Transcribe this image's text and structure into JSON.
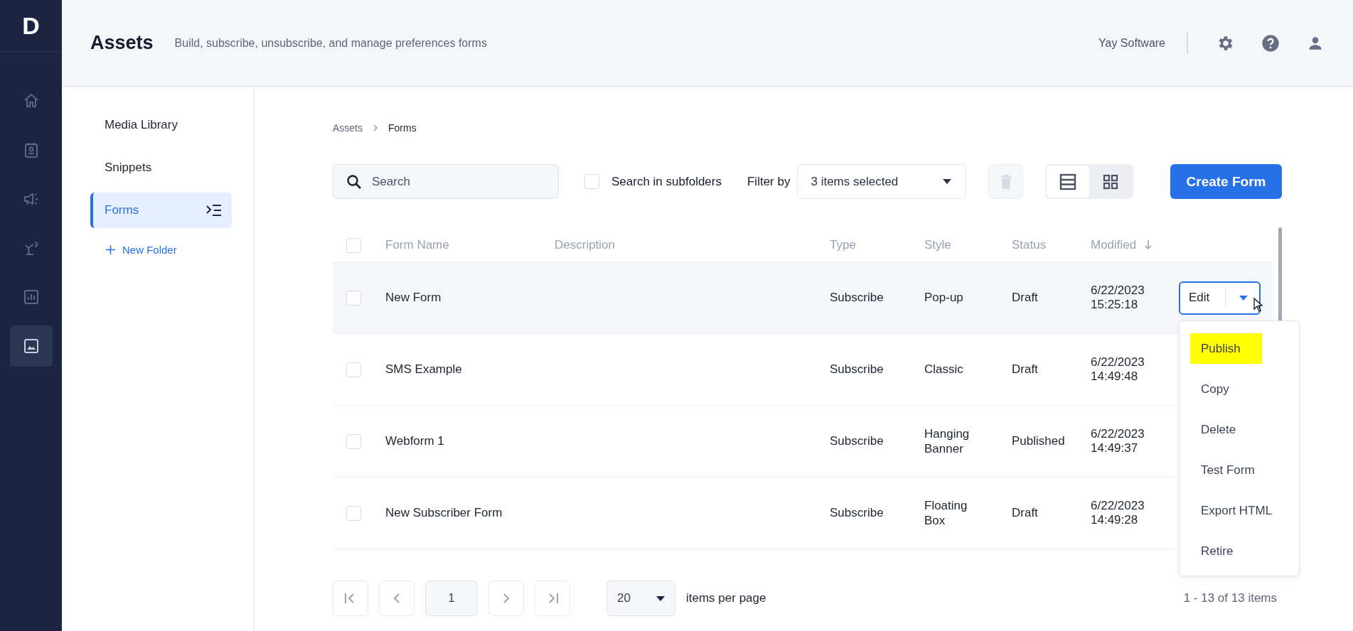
{
  "rail": {
    "logo": "D",
    "items": [
      {
        "kind": "home",
        "selected": false
      },
      {
        "kind": "contacts",
        "selected": false
      },
      {
        "kind": "campaigns",
        "selected": false
      },
      {
        "kind": "automation",
        "selected": false
      },
      {
        "kind": "reports",
        "selected": false
      },
      {
        "kind": "assets",
        "selected": true
      }
    ]
  },
  "header": {
    "title": "Assets",
    "subtitle": "Build, subscribe, unsubscribe, and manage preferences forms",
    "account": "Yay Software"
  },
  "side_panel": {
    "items": [
      {
        "label": "Media Library",
        "selected": false
      },
      {
        "label": "Snippets",
        "selected": false
      },
      {
        "label": "Forms",
        "selected": true
      }
    ],
    "new_folder": "New Folder"
  },
  "breadcrumb": [
    "Assets",
    "Forms"
  ],
  "toolbar": {
    "search": {
      "placeholder": "Search"
    },
    "subfolders": {
      "label": "Search in subfolders",
      "checked": false
    },
    "filter_label": "Filter by",
    "filter_value": "3 items selected",
    "views": [
      {
        "kind": "list",
        "selected": true
      },
      {
        "kind": "grid",
        "selected": false
      }
    ],
    "create_button": "Create Form"
  },
  "table": {
    "all_checked": false,
    "columns": [
      {
        "label": "Form Name",
        "sorted": false
      },
      {
        "label": "Description",
        "sorted": false
      },
      {
        "label": "Type",
        "sorted": false
      },
      {
        "label": "Style",
        "sorted": false
      },
      {
        "label": "Status",
        "sorted": false
      },
      {
        "label": "Modified",
        "sorted": true
      }
    ],
    "rows": [
      {
        "checked": false,
        "hovered": true,
        "name": "New Form",
        "type": "Subscribe",
        "style": "Pop-up",
        "status": "Draft",
        "date": "6/22/2023",
        "time": "15:25:18"
      },
      {
        "checked": false,
        "hovered": false,
        "name": "SMS Example",
        "type": "Subscribe",
        "style": "Classic",
        "status": "Draft",
        "date": "6/22/2023",
        "time": "14:49:48"
      },
      {
        "checked": false,
        "hovered": false,
        "name": "Webform 1",
        "type": "Subscribe",
        "style": "Hanging Banner",
        "status": "Published",
        "date": "6/22/2023",
        "time": "14:49:37"
      },
      {
        "checked": false,
        "hovered": false,
        "name": "New Subscriber Form",
        "type": "Subscribe",
        "style": "Floating Box",
        "status": "Draft",
        "date": "6/22/2023",
        "time": "14:49:28"
      }
    ],
    "row_action": "Edit"
  },
  "action_menu": {
    "items": [
      {
        "label": "Publish",
        "highlighted": true
      },
      {
        "label": "Copy",
        "highlighted": false
      },
      {
        "label": "Delete",
        "highlighted": false
      },
      {
        "label": "Test Form",
        "highlighted": false
      },
      {
        "label": "Export HTML",
        "highlighted": false
      },
      {
        "label": "Retire",
        "highlighted": false
      }
    ]
  },
  "pagination": {
    "page": "1",
    "per_page": "20",
    "per_page_label": "items per page",
    "summary": "1 - 13 of 13 items"
  }
}
